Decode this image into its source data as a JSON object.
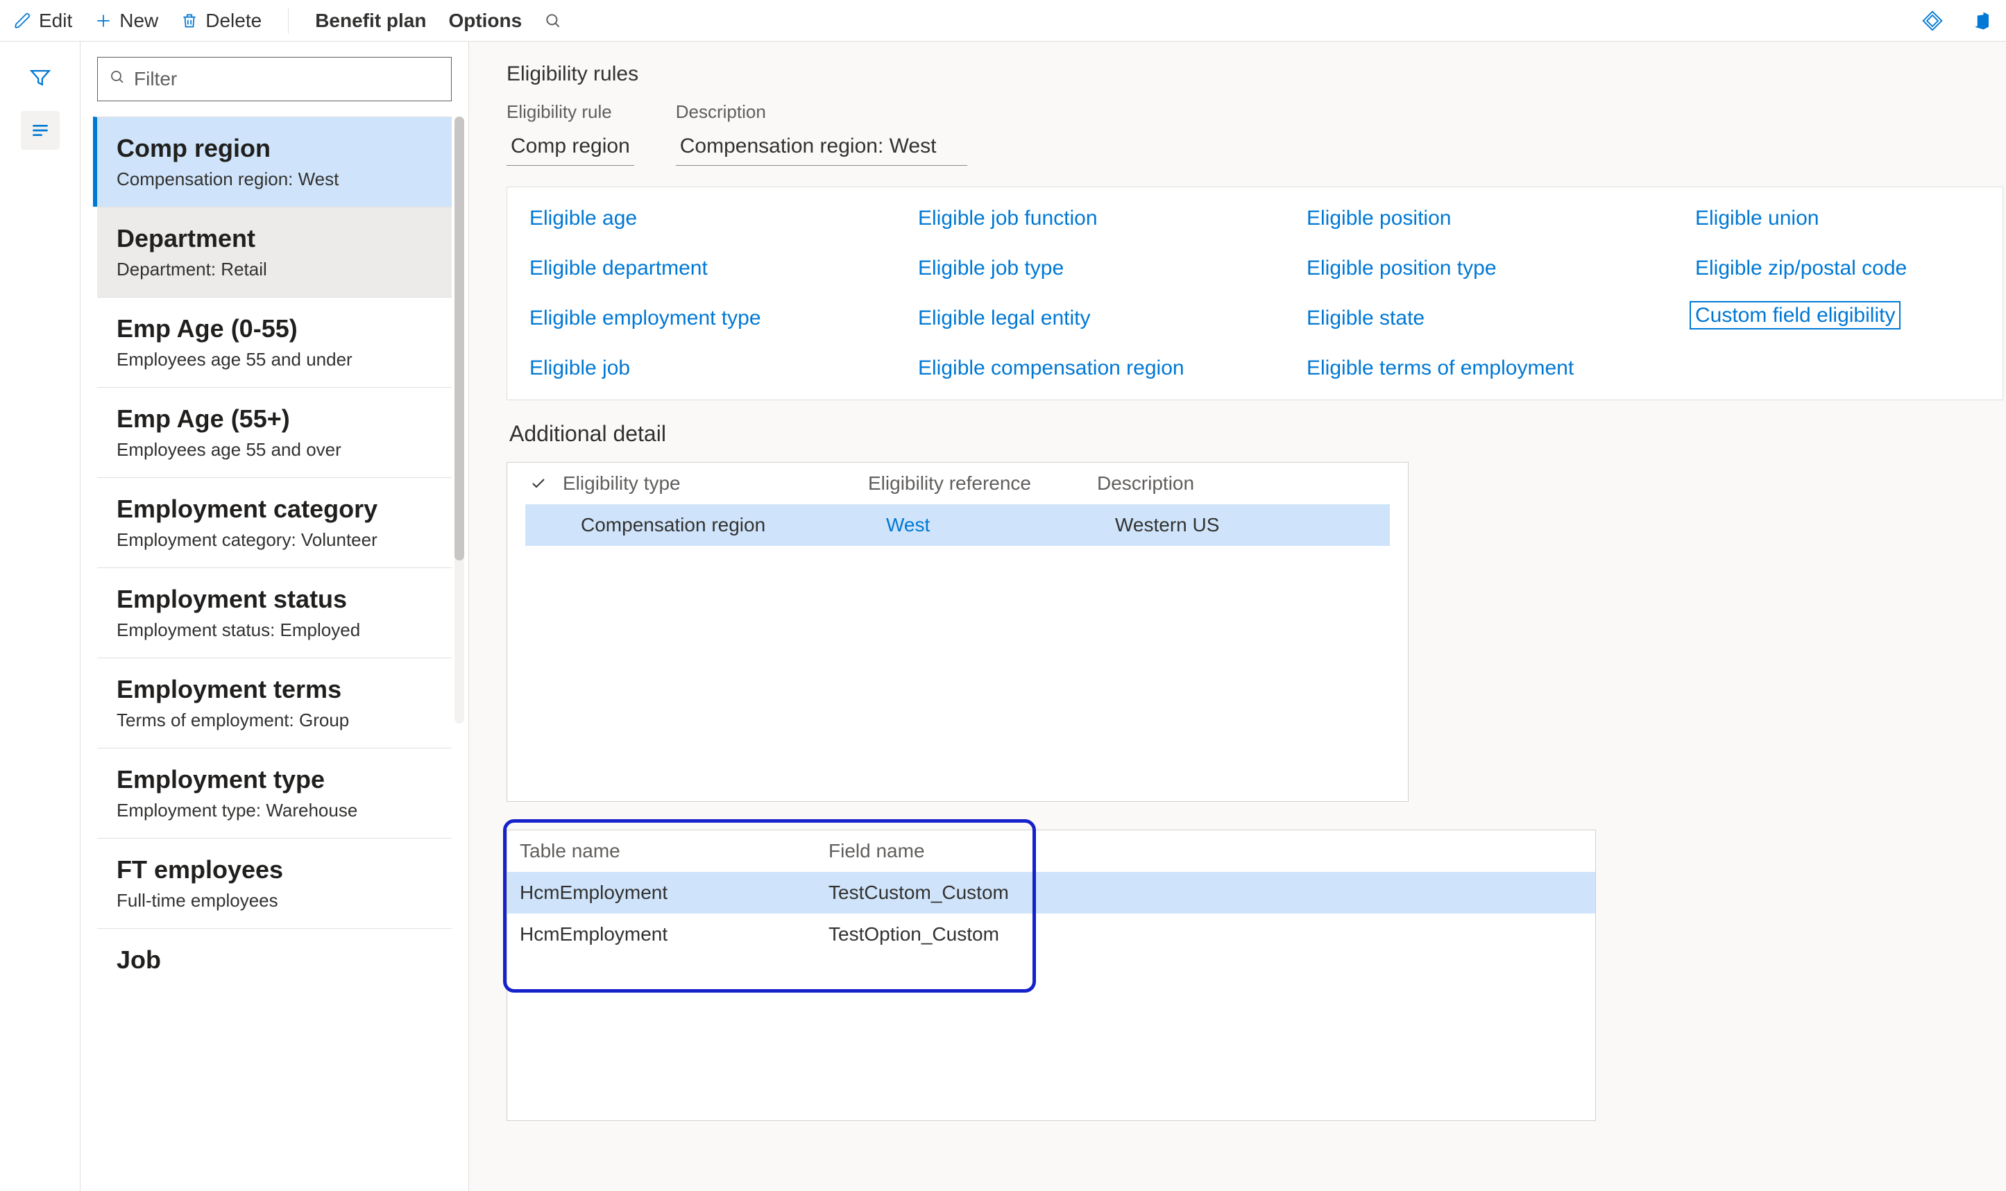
{
  "toolbar": {
    "edit": "Edit",
    "new": "New",
    "delete": "Delete",
    "benefit_plan": "Benefit plan",
    "options": "Options"
  },
  "filter_placeholder": "Filter",
  "rules": [
    {
      "title": "Comp region",
      "sub": "Compensation region:  West"
    },
    {
      "title": "Department",
      "sub": "Department:  Retail"
    },
    {
      "title": "Emp Age (0-55)",
      "sub": "Employees age 55 and under"
    },
    {
      "title": "Emp Age (55+)",
      "sub": "Employees age 55 and over"
    },
    {
      "title": "Employment category",
      "sub": "Employment category:  Volunteer"
    },
    {
      "title": "Employment status",
      "sub": "Employment status: Employed"
    },
    {
      "title": "Employment terms",
      "sub": "Terms of employment: Group"
    },
    {
      "title": "Employment type",
      "sub": "Employment type: Warehouse"
    },
    {
      "title": "FT employees",
      "sub": "Full-time employees"
    },
    {
      "title": "Job",
      "sub": ""
    }
  ],
  "main": {
    "page_title": "Eligibility rules",
    "field_rule_label": "Eligibility rule",
    "field_rule_value": "Comp region",
    "field_desc_label": "Description",
    "field_desc_value": "Compensation region:  West"
  },
  "eligibility_links": {
    "c1": [
      "Eligible age",
      "Eligible department",
      "Eligible employment type",
      "Eligible job"
    ],
    "c2": [
      "Eligible job function",
      "Eligible job type",
      "Eligible legal entity",
      "Eligible compensation region"
    ],
    "c3": [
      "Eligible position",
      "Eligible position type",
      "Eligible state",
      "Eligible terms of employment"
    ],
    "c4": [
      "Eligible union",
      "Eligible zip/postal code",
      "Custom field eligibility"
    ]
  },
  "detail": {
    "section_title": "Additional detail",
    "headers": {
      "type": "Eligibility type",
      "ref": "Eligibility reference",
      "desc": "Description"
    },
    "row": {
      "type": "Compensation region",
      "ref": "West",
      "desc": "Western US"
    }
  },
  "custom": {
    "headers": {
      "table": "Table name",
      "field": "Field name"
    },
    "rows": [
      {
        "table": "HcmEmployment",
        "field": "TestCustom_Custom"
      },
      {
        "table": "HcmEmployment",
        "field": "TestOption_Custom"
      }
    ]
  }
}
